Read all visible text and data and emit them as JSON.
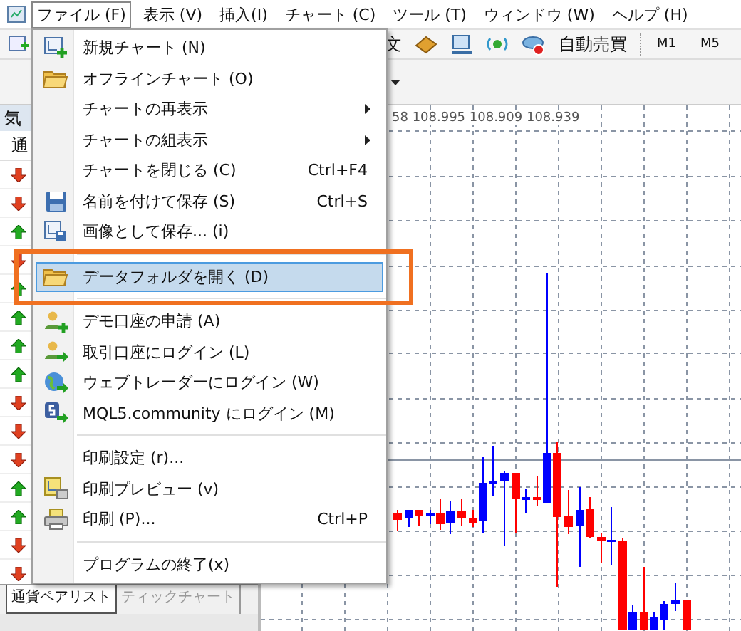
{
  "menu_bar": [
    {
      "label": "ファイル (F)",
      "selected": true
    },
    {
      "label": "表示 (V)",
      "selected": false
    },
    {
      "label": "挿入(I)",
      "selected": false
    },
    {
      "label": "チャート (C)",
      "selected": false
    },
    {
      "label": "ツール (T)",
      "selected": false
    },
    {
      "label": "ウィンドウ (W)",
      "selected": false
    },
    {
      "label": "ヘルプ (H)",
      "selected": false
    }
  ],
  "toolbar": {
    "order_label": "文",
    "auto_trading": "自動売買",
    "timeframes": [
      "M1",
      "M5"
    ]
  },
  "market_watch": {
    "title": "気",
    "column_1": "通",
    "rows": [
      {
        "kind": "down"
      },
      {
        "kind": "down"
      },
      {
        "kind": "up"
      },
      {
        "kind": "down"
      },
      {
        "kind": "up"
      },
      {
        "kind": "up"
      },
      {
        "kind": "up"
      },
      {
        "kind": "up"
      },
      {
        "kind": "down"
      },
      {
        "kind": "down"
      },
      {
        "kind": "down"
      },
      {
        "kind": "up"
      },
      {
        "kind": "up"
      },
      {
        "kind": "down"
      },
      {
        "kind": "down"
      }
    ],
    "tabs": [
      {
        "label": "通貨ペアリスト",
        "selected": true
      },
      {
        "label": "ティックチャート",
        "selected": false
      }
    ]
  },
  "chart": {
    "price_label": "58 108.995 108.909 108.939"
  },
  "file_menu": [
    {
      "kind": "item",
      "label": "新規チャート (N)",
      "submenu": false,
      "selected": false
    },
    {
      "kind": "item",
      "label": "オフラインチャート (O)",
      "submenu": false,
      "selected": false
    },
    {
      "kind": "item",
      "label": "チャートの再表示",
      "submenu": true,
      "selected": false
    },
    {
      "kind": "item",
      "label": "チャートの組表示",
      "submenu": true,
      "selected": false
    },
    {
      "kind": "item",
      "label": "チャートを閉じる (C)",
      "shortcut": "Ctrl+F4",
      "submenu": false,
      "selected": false
    },
    {
      "kind": "item",
      "label": "名前を付けて保存 (S)",
      "shortcut": "Ctrl+S",
      "submenu": false,
      "selected": false
    },
    {
      "kind": "item",
      "label": "画像として保存... (i)",
      "submenu": false,
      "selected": false
    },
    {
      "kind": "separator"
    },
    {
      "kind": "item",
      "label": "データフォルダを開く (D)",
      "submenu": false,
      "selected": true
    },
    {
      "kind": "separator"
    },
    {
      "kind": "item",
      "label": "デモ口座の申請 (A)",
      "submenu": false,
      "selected": false
    },
    {
      "kind": "item",
      "label": "取引口座にログイン (L)",
      "submenu": false,
      "selected": false
    },
    {
      "kind": "item",
      "label": "ウェブトレーダーにログイン (W)",
      "submenu": false,
      "selected": false
    },
    {
      "kind": "item",
      "label": "MQL5.community にログイン (M)",
      "submenu": false,
      "selected": false
    },
    {
      "kind": "separator"
    },
    {
      "kind": "item",
      "label": "印刷設定 (r)...",
      "submenu": false,
      "selected": false
    },
    {
      "kind": "item",
      "label": "印刷プレビュー (v)",
      "submenu": false,
      "selected": false
    },
    {
      "kind": "item",
      "label": "印刷 (P)...",
      "shortcut": "Ctrl+P",
      "submenu": false,
      "selected": false
    },
    {
      "kind": "separator"
    },
    {
      "kind": "item",
      "label": "プログラムの終了(x)",
      "submenu": false,
      "selected": false
    }
  ]
}
